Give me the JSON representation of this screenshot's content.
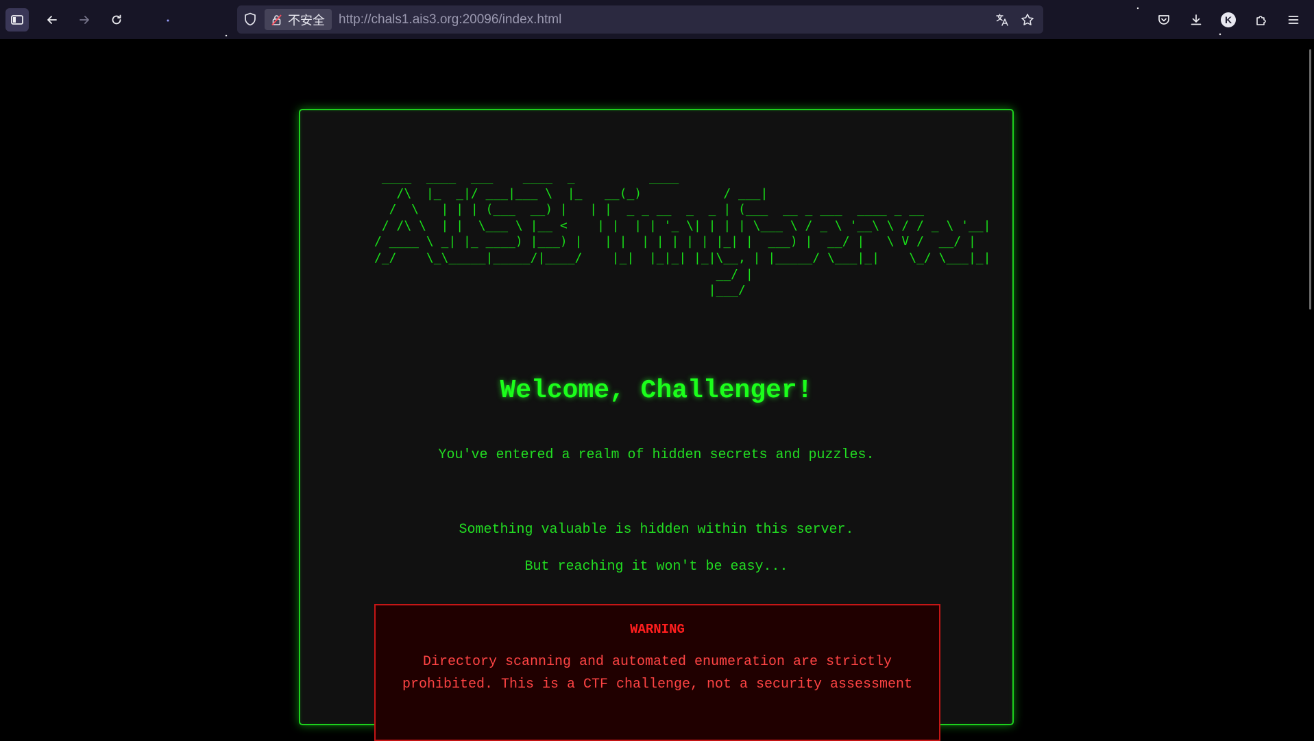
{
  "browser": {
    "security_label": "不安全",
    "url": "http://chals1.ais3.org:20096/index.html",
    "profile_initial": "K"
  },
  "page": {
    "ascii_logo": " ____  ____  ___    ____  _          ____\n   /\\  |_  _|/ ___|___ \\  |_   __(_)           / ___|\n  /  \\   | | | (___  __) |   | |  _ _ __  _  _ | (___  __ _ ___  ____ _ __\n / /\\ \\  | |  \\___ \\ |__ <    | |  | | '_ \\| | | | \\___ \\ / _ \\ '__\\ \\ / / _ \\ '__|\n/ ____ \\ _| |_ ____) |___) |   | |  | | | | | |_| |  ___) |  __/ |   \\ V /  __/ |\n/_/    \\_\\_____|_____/|____/    |_|  |_|_| |_|\\__, | |_____/ \\___|_|    \\_/ \\___|_|\n                                              __/ |\n                                             |___/",
    "welcome": "Welcome, Challenger!",
    "intro": "You've entered a realm of hidden secrets and puzzles.",
    "line1": "Something valuable is hidden within this server.",
    "line2": "But reaching it won't be easy...",
    "warning_title": "WARNING",
    "warning_text": "Directory scanning and automated enumeration are strictly prohibited. This is a CTF challenge, not a security assessment"
  },
  "colors": {
    "accent_green": "#1bff1b",
    "warning_red": "#ff1e1e",
    "card_background": "#111111"
  },
  "icons": [
    "sidebar-icon",
    "back-arrow-icon",
    "forward-arrow-icon",
    "reload-icon",
    "shield-icon",
    "insecure-lock-icon",
    "translate-icon",
    "bookmark-star-icon",
    "pocket-icon",
    "download-icon",
    "extensions-icon",
    "menu-icon"
  ]
}
